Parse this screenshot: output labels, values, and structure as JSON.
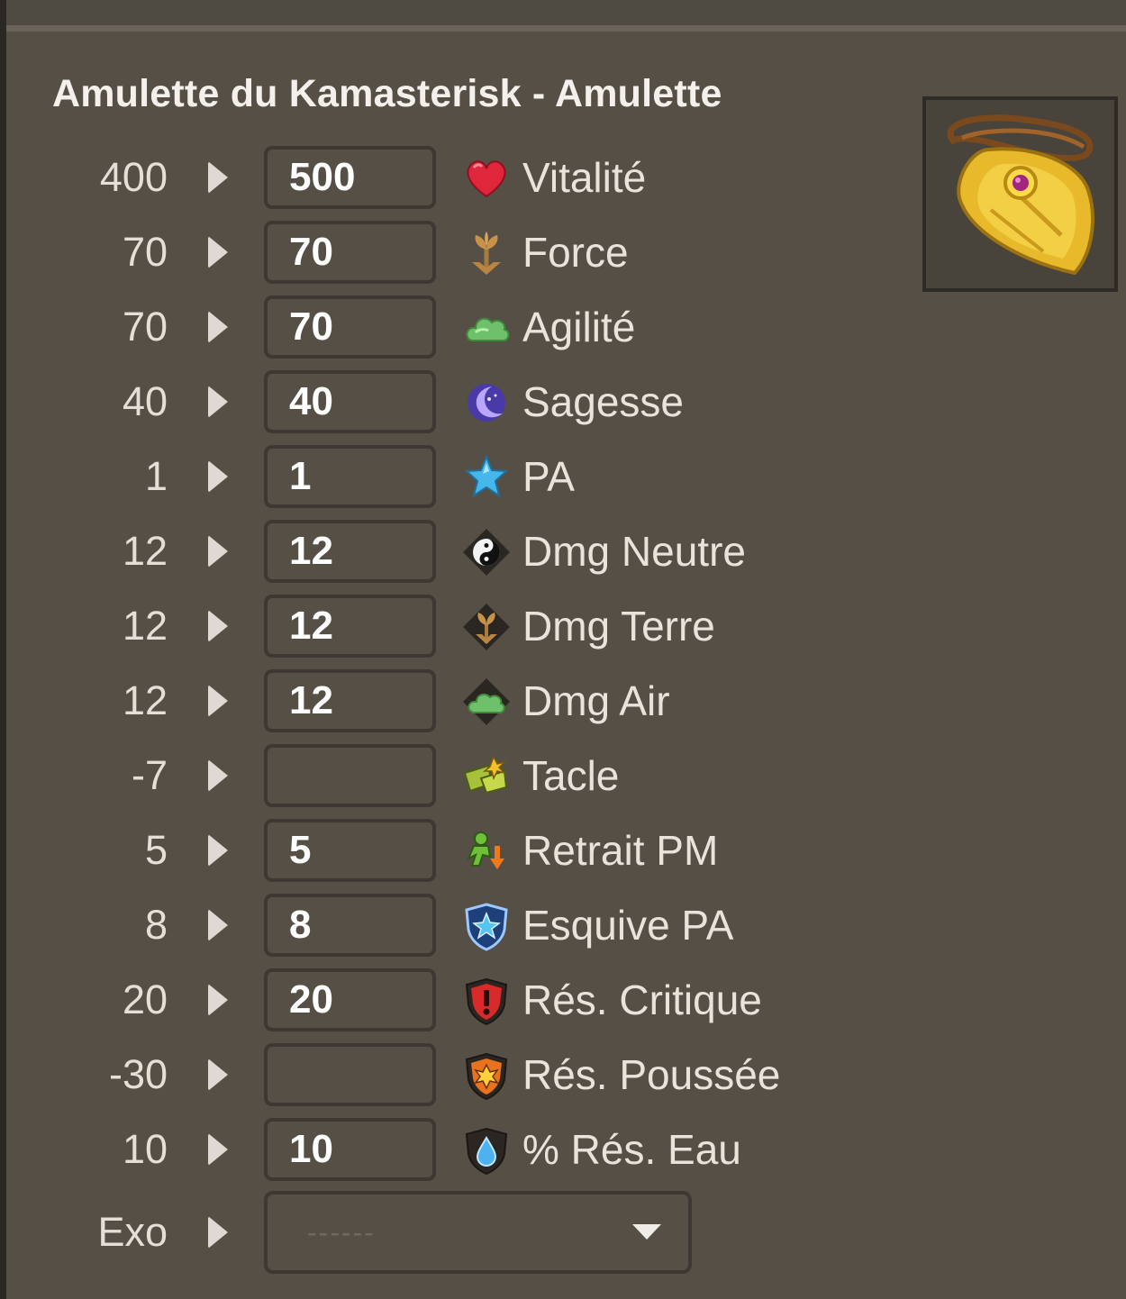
{
  "item": {
    "title": "Amulette du Kamasterisk - Amulette",
    "image_icon": "gold-amulet-icon"
  },
  "stats": [
    {
      "base": "400",
      "value": "500",
      "name": "Vitalité",
      "icon": "heart-icon"
    },
    {
      "base": "70",
      "value": "70",
      "name": "Force",
      "icon": "earth-icon"
    },
    {
      "base": "70",
      "value": "70",
      "name": "Agilité",
      "icon": "air-cloud-icon"
    },
    {
      "base": "40",
      "value": "40",
      "name": "Sagesse",
      "icon": "wisdom-moon-icon"
    },
    {
      "base": "1",
      "value": "1",
      "name": "PA",
      "icon": "star-icon"
    },
    {
      "base": "12",
      "value": "12",
      "name": "Dmg Neutre",
      "icon": "neutral-yin-yang-icon"
    },
    {
      "base": "12",
      "value": "12",
      "name": "Dmg Terre",
      "icon": "earth-damage-icon"
    },
    {
      "base": "12",
      "value": "12",
      "name": "Dmg Air",
      "icon": "air-damage-icon"
    },
    {
      "base": "-7",
      "value": "",
      "name": "Tacle",
      "icon": "lock-tackle-icon"
    },
    {
      "base": "5",
      "value": "5",
      "name": "Retrait PM",
      "icon": "mp-reduction-icon"
    },
    {
      "base": "8",
      "value": "8",
      "name": "Esquive PA",
      "icon": "ap-dodge-shield-icon"
    },
    {
      "base": "20",
      "value": "20",
      "name": "Rés. Critique",
      "icon": "critical-resistance-shield-icon"
    },
    {
      "base": "-30",
      "value": "",
      "name": "Rés. Poussée",
      "icon": "pushback-resistance-shield-icon"
    },
    {
      "base": "10",
      "value": "10",
      "name": "% Rés. Eau",
      "icon": "water-resistance-icon"
    }
  ],
  "exo": {
    "label": "Exo",
    "selected": "------"
  },
  "colors": {
    "background": "#554f46",
    "input_border": "#3d3832",
    "text": "#e8e4dc"
  }
}
